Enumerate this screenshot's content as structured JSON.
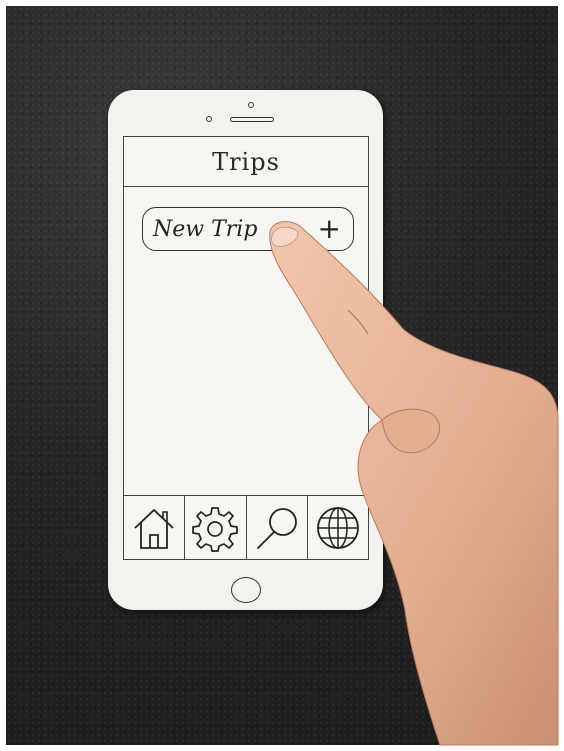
{
  "screen": {
    "title": "Trips",
    "new_trip_button": {
      "label": "New Trip",
      "icon": "+"
    }
  },
  "tabbar": {
    "items": [
      {
        "icon": "home-icon"
      },
      {
        "icon": "gear-icon"
      },
      {
        "icon": "search-icon"
      },
      {
        "icon": "globe-icon"
      }
    ]
  },
  "colors": {
    "background": "#262626",
    "paper": "#f3f2ee",
    "ink": "#2a2a2a",
    "skin": "#e7b79a"
  }
}
